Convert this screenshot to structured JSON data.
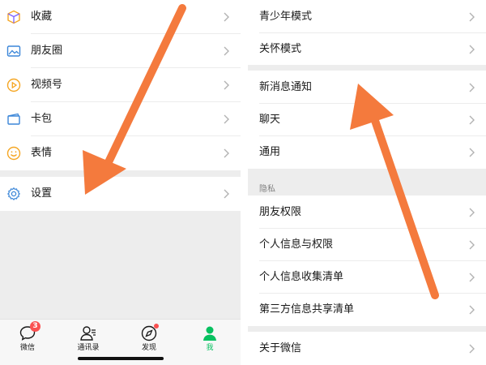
{
  "left_panel": {
    "items": [
      {
        "label": "收藏",
        "icon": "cube-icon"
      },
      {
        "label": "朋友圈",
        "icon": "image-icon"
      },
      {
        "label": "视频号",
        "icon": "play-circle-icon"
      },
      {
        "label": "卡包",
        "icon": "card-icon"
      },
      {
        "label": "表情",
        "icon": "smiley-icon"
      }
    ],
    "settings": {
      "label": "设置",
      "icon": "gear-icon"
    },
    "tabbar": {
      "tabs": [
        {
          "label": "微信",
          "icon": "chat-bubble-icon",
          "badge": "3"
        },
        {
          "label": "通讯录",
          "icon": "contacts-icon"
        },
        {
          "label": "发现",
          "icon": "compass-icon"
        },
        {
          "label": "我",
          "icon": "person-icon"
        }
      ],
      "active_tab": "我"
    }
  },
  "right_panel": {
    "group1": [
      {
        "label": "青少年模式"
      },
      {
        "label": "关怀模式"
      }
    ],
    "group2": [
      {
        "label": "新消息通知"
      },
      {
        "label": "聊天"
      },
      {
        "label": "通用"
      }
    ],
    "privacy_header": "隐私",
    "group3": [
      {
        "label": "朋友权限"
      },
      {
        "label": "个人信息与权限"
      },
      {
        "label": "个人信息收集清单"
      },
      {
        "label": "第三方信息共享清单"
      }
    ],
    "group4": [
      {
        "label": "关于微信"
      }
    ]
  },
  "colors": {
    "accent_green": "#07c160",
    "badge_red": "#fa5151",
    "arrow_orange": "#f47a3d",
    "background_gray": "#ededed"
  }
}
